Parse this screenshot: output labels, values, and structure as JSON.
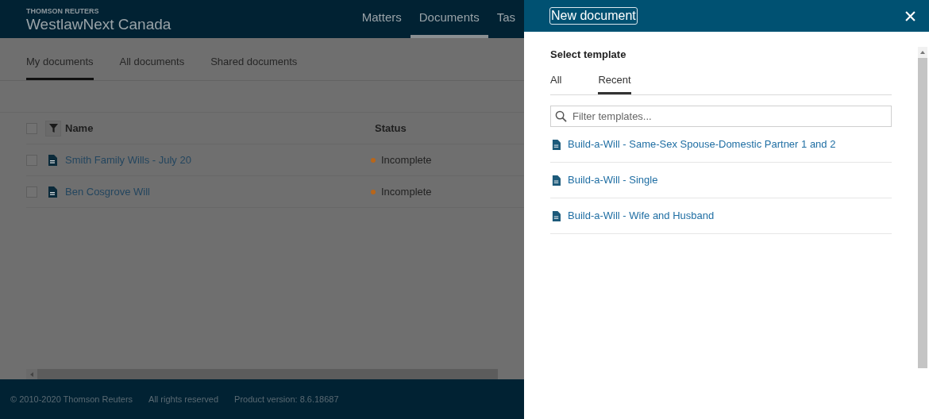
{
  "header": {
    "brand": "THOMSON REUTERS",
    "product": "WestlawNext Canada",
    "nav": [
      {
        "label": "Matters",
        "selected": false
      },
      {
        "label": "Documents",
        "selected": true
      },
      {
        "label": "Tas",
        "selected": false
      }
    ]
  },
  "subtabs": [
    {
      "label": "My documents",
      "selected": true
    },
    {
      "label": "All documents",
      "selected": false
    },
    {
      "label": "Shared documents",
      "selected": false
    }
  ],
  "table": {
    "select_all_checked": false,
    "columns": [
      "Name",
      "Status"
    ],
    "rows": [
      {
        "checked": false,
        "name": "Smith Family Wills - July 20",
        "status": "Incomplete",
        "color": "#b8661a"
      },
      {
        "checked": false,
        "name": "Ben Cosgrove Will",
        "status": "Incomplete",
        "color": "#b8661a"
      }
    ]
  },
  "footer": [
    "© 2010-2020 Thomson Reuters",
    "All rights reserved",
    "Product version: 8.6.18687"
  ],
  "drawer": {
    "title": "New document",
    "section": "Select template",
    "tabs": [
      {
        "label": "All",
        "selected": false
      },
      {
        "label": "Recent",
        "selected": true
      }
    ],
    "filter": {
      "placeholder": "Filter templates..."
    },
    "templates": [
      "Build-a-Will - Same-Sex Spouse-Domestic Partner 1 and 2",
      "Build-a-Will - Single",
      "Build-a-Will - Wife and Husband"
    ]
  }
}
